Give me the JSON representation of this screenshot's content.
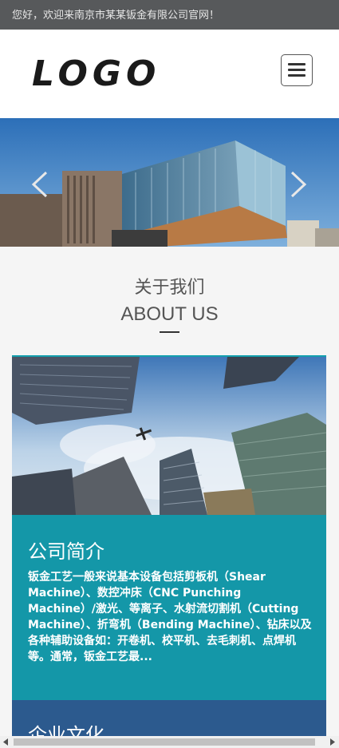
{
  "topbar": {
    "welcome_text": "您好，欢迎来南京市某某钣金有限公司官网！"
  },
  "header": {
    "logo_text": "LOGO"
  },
  "about": {
    "title_cn": "关于我们",
    "title_en": "ABOUT US",
    "intro_card": {
      "title": "公司简介",
      "text": "钣金工艺一般来说基本设备包括剪板机（Shear Machine）、数控冲床（CNC Punching Machine）/激光、等离子、水射流切割机（Cutting Machine）、折弯机（Bending Machine）、钻床以及各种辅助设备如：开卷机、校平机、去毛刺机、点焊机等。通常，钣金工艺最..."
    },
    "culture_card": {
      "title": "企业文化"
    }
  },
  "colors": {
    "topbar_bg": "#57595b",
    "intro_card_bg": "#1497a8",
    "culture_card_bg": "#2c5a8e"
  }
}
